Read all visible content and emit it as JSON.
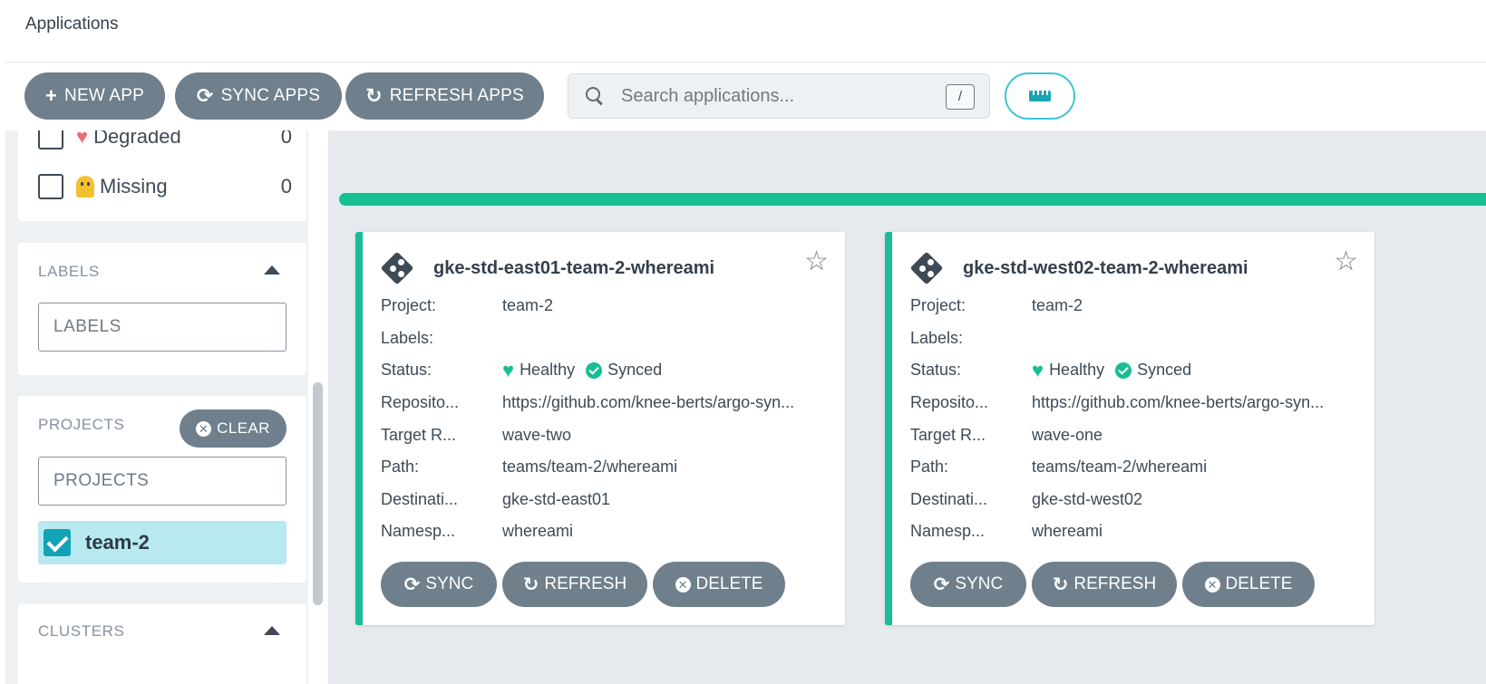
{
  "header": {
    "title": "Applications"
  },
  "toolbar": {
    "new_app": {
      "icon": "plus-icon",
      "label": "NEW APP"
    },
    "sync_apps": {
      "icon": "sync-icon",
      "label": "SYNC APPS"
    },
    "refresh_apps": {
      "icon": "refresh-icon",
      "label": "REFRESH APPS"
    },
    "search": {
      "placeholder": "Search applications...",
      "value": "",
      "shortcut": "/"
    },
    "view_toggle": {
      "icon": "ruler-icon"
    }
  },
  "sidebar": {
    "health_filters": [
      {
        "label": "Degraded",
        "count": "0",
        "icon": "broken-heart-icon"
      },
      {
        "label": "Missing",
        "count": "0",
        "icon": "ghost-icon"
      }
    ],
    "labels": {
      "title": "LABELS",
      "placeholder": "LABELS"
    },
    "projects": {
      "title": "PROJECTS",
      "clear_label": "CLEAR",
      "placeholder": "PROJECTS",
      "selected": "team-2"
    },
    "clusters": {
      "title": "CLUSTERS"
    }
  },
  "colors": {
    "accent": "#18be94",
    "button": "#6f7f8c",
    "selection": "#b9e9f0"
  },
  "cards": [
    {
      "title": "gke-std-east01-team-2-whereami",
      "fields": [
        {
          "key": "Project:",
          "value": "team-2"
        },
        {
          "key": "Labels:",
          "value": ""
        },
        {
          "key": "Status:",
          "health": "Healthy",
          "sync": "Synced"
        },
        {
          "key": "Reposito...",
          "value": "https://github.com/knee-berts/argo-syn..."
        },
        {
          "key": "Target R...",
          "value": "wave-two"
        },
        {
          "key": "Path:",
          "value": "teams/team-2/whereami"
        },
        {
          "key": "Destinati...",
          "value": "gke-std-east01"
        },
        {
          "key": "Namesp...",
          "value": "whereami"
        }
      ],
      "actions": {
        "sync": "SYNC",
        "refresh": "REFRESH",
        "delete": "DELETE"
      }
    },
    {
      "title": "gke-std-west02-team-2-whereami",
      "fields": [
        {
          "key": "Project:",
          "value": "team-2"
        },
        {
          "key": "Labels:",
          "value": ""
        },
        {
          "key": "Status:",
          "health": "Healthy",
          "sync": "Synced"
        },
        {
          "key": "Reposito...",
          "value": "https://github.com/knee-berts/argo-syn..."
        },
        {
          "key": "Target R...",
          "value": "wave-one"
        },
        {
          "key": "Path:",
          "value": "teams/team-2/whereami"
        },
        {
          "key": "Destinati...",
          "value": "gke-std-west02"
        },
        {
          "key": "Namesp...",
          "value": "whereami"
        }
      ],
      "actions": {
        "sync": "SYNC",
        "refresh": "REFRESH",
        "delete": "DELETE"
      }
    }
  ]
}
